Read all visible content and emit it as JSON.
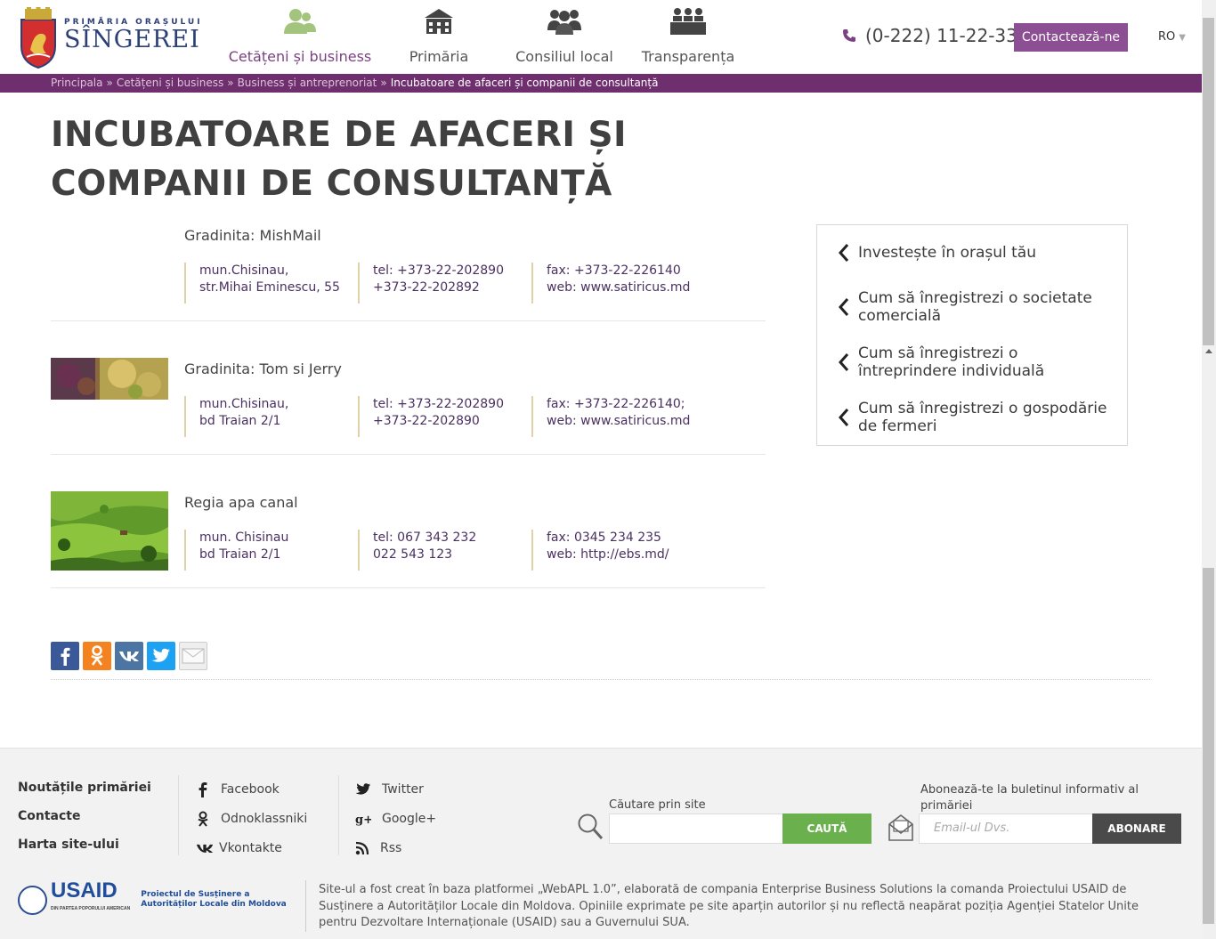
{
  "header": {
    "logo_top": "PRIMĂRIA ORAȘULUI",
    "logo_main": "SÎNGEREI",
    "nav": [
      {
        "label": "Cetățeni și business",
        "icon": "people-icon",
        "active": true
      },
      {
        "label": "Primăria",
        "icon": "building-icon",
        "active": false
      },
      {
        "label": "Consiliul local",
        "icon": "council-icon",
        "active": false
      },
      {
        "label": "Transparența",
        "icon": "meeting-icon",
        "active": false
      }
    ],
    "phone": "(0-222) 11-22-33",
    "contact_label": "Contactează-ne",
    "lang": "RO"
  },
  "breadcrumb": {
    "items": [
      "Principala",
      "Cetățeni și business",
      "Business și antreprenoriat"
    ],
    "current": "Incubatoare de afaceri și companii de consultanță"
  },
  "page_title": "INCUBATOARE DE AFACERI ȘI COMPANII DE CONSULTANȚĂ",
  "entries": [
    {
      "name": "Gradinita: MishMail",
      "addr1": "mun.Chisinau,",
      "addr2": "str.Mihai Eminescu, 55",
      "tel1": "tel: +373-22-202890",
      "tel2": "+373-22-202892",
      "fax": "fax: +373-22-226140",
      "web": "web: www.satiricus.md",
      "thumb": "none"
    },
    {
      "name": "Gradinita: Tom si Jerry",
      "addr1": "mun.Chisinau,",
      "addr2": "bd Traian 2/1",
      "tel1": "tel: +373-22-202890",
      "tel2": "+373-22-202890",
      "fax": "fax: +373-22-226140;",
      "web": "web: www.satiricus.md",
      "thumb": "flowers"
    },
    {
      "name": "Regia apa canal",
      "addr1": "mun. Chisinau",
      "addr2": "bd Traian 2/1",
      "tel1": "tel: 067 343 232",
      "tel2": "022 543 123",
      "fax": "fax: 0345 234 235",
      "web": "web: http://ebs.md/",
      "thumb": "hills"
    }
  ],
  "sidebar": {
    "items": [
      "Investește în orașul tău",
      "Cum să înregistrezi o societate comercială",
      "Cum să înregistrezi o întreprindere individuală",
      "Cum să înregistrezi o gospodărie de fermeri"
    ]
  },
  "share": {
    "buttons": [
      "facebook",
      "odnoklassniki",
      "vkontakte",
      "twitter",
      "email"
    ],
    "colors": {
      "facebook": "#3b5998",
      "odnoklassniki": "#f58220",
      "vkontakte": "#4c75a3",
      "twitter": "#1da1f2",
      "email": "#eeeeee"
    }
  },
  "footer": {
    "links": [
      "Noutățile primăriei",
      "Contacte",
      "Harta site-ului"
    ],
    "social_left": [
      "Facebook",
      "Odnoklassniki",
      "Vkontakte"
    ],
    "social_right": [
      "Twitter",
      "Google+",
      "Rss"
    ],
    "search_label": "Căutare prin site",
    "search_button": "CAUTĂ",
    "subscribe_label": "Abonează-te la buletinul informativ al primăriei",
    "subscribe_placeholder": "Email-ul Dvs.",
    "subscribe_button": "ABONARE",
    "usaid_word": "USAID",
    "usaid_small": "DIN PARTEA POPORULUI AMERICAN",
    "usaid_project": "Proiectul de Susținere a Autorităților Locale din Moldova",
    "note": "Site-ul a fost creat în baza platformei „WebAPL 1.0”, elaborată de compania Enterprise Business Solutions la comanda Proiectului USAID de Susținere a Autorităților Locale din Moldova. Opiniile exprimate pe site aparțin autorilor și nu reflectă neapărat poziția Agenției Statelor Unite pentru Dezvoltare Internaționale (USAID) sau a Guvernului SUA."
  },
  "colors": {
    "accent": "#8d4f93",
    "breadcrumb_bg": "#6f2f6e",
    "search_button": "#6ab04c",
    "subscribe_button": "#4a4a4a"
  }
}
